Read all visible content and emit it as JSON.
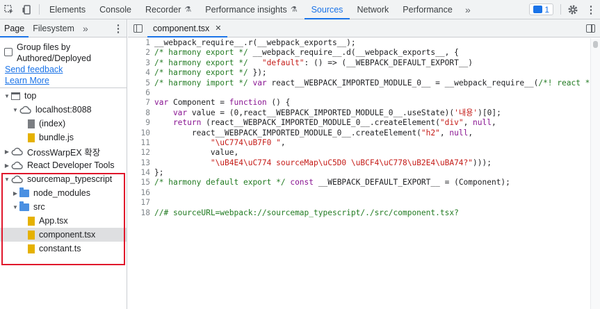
{
  "toolbar": {
    "tabs": [
      {
        "label": "Elements"
      },
      {
        "label": "Console"
      },
      {
        "label": "Recorder"
      },
      {
        "label": "Performance insights"
      },
      {
        "label": "Sources"
      },
      {
        "label": "Network"
      },
      {
        "label": "Performance"
      }
    ],
    "active_tab": "Sources",
    "issues_count": "1",
    "icons": [
      "inspect-icon",
      "device-toggle-icon",
      "more-tabs-icon",
      "issues-icon",
      "settings-icon",
      "kebab-menu-icon"
    ],
    "accent_color": "#1a73e8"
  },
  "navigator": {
    "tabs": [
      {
        "label": "Page"
      },
      {
        "label": "Filesystem"
      }
    ],
    "more_label": "»",
    "group_files_label": "Group files by Authored/Deployed",
    "group_files_checked": false,
    "send_feedback": "Send feedback",
    "learn_more": "Learn More",
    "tree": {
      "top": "top",
      "localhost": "localhost:8088",
      "index": "(index)",
      "bundle": "bundle.js",
      "crosswarp": "CrossWarpEX 확장",
      "react_dev": "React Developer Tools",
      "sourcemap": "sourcemap_typescript",
      "node_modules": "node_modules",
      "src": "src",
      "app": "App.tsx",
      "component": "component.tsx",
      "constant": "constant.ts"
    },
    "selected_file": "component.tsx",
    "highlight_color": "#e0162b"
  },
  "editor": {
    "open_file": "component.tsx",
    "close_label": "✕",
    "lines": [
      {
        "n": "1"
      },
      {
        "n": "2"
      },
      {
        "n": "3"
      },
      {
        "n": "4"
      },
      {
        "n": "5"
      },
      {
        "n": "6"
      },
      {
        "n": "7"
      },
      {
        "n": "8"
      },
      {
        "n": "9"
      },
      {
        "n": "10"
      },
      {
        "n": "11"
      },
      {
        "n": "12"
      },
      {
        "n": "13"
      },
      {
        "n": "14"
      },
      {
        "n": "15"
      },
      {
        "n": "16"
      },
      {
        "n": "17"
      },
      {
        "n": "18"
      }
    ],
    "code": {
      "l1": "__webpack_require__.r(__webpack_exports__);",
      "l2a": "/* harmony export */",
      "l2b": " __webpack_require__.d(__webpack_exports__, {",
      "l3a": "/* harmony export */",
      "l3b": "   \"default\"",
      "l3c": ": () => (__WEBPACK_DEFAULT_EXPORT__)",
      "l4a": "/* harmony export */",
      "l4b": " });",
      "l5a": "/* harmony import */",
      "l5b": " var",
      "l5c": " react__WEBPACK_IMPORTED_MODULE_0__ = __webpack_require__(",
      "l5d": "/*! react */",
      "l7a": "var",
      "l7b": " Component = ",
      "l7c": "function",
      "l7d": " () {",
      "l8a": "    var",
      "l8b": " value = (0,react__WEBPACK_IMPORTED_MODULE_0__.useState)(",
      "l8c": "'내용'",
      "l8d": ")[0];",
      "l9a": "    return",
      "l9b": " (react__WEBPACK_IMPORTED_MODULE_0__.createElement(",
      "l9c": "\"div\"",
      "l9d": ", ",
      "l9e": "null",
      "l9f": ",",
      "l10a": "        react__WEBPACK_IMPORTED_MODULE_0__.createElement(",
      "l10b": "\"h2\"",
      "l10c": ", ",
      "l10d": "null",
      "l10e": ",",
      "l11": "\"\\uC774\\uB7F0 \"",
      "l11b": ",",
      "l12": "            value,",
      "l13a": "\"\\uB4E4\\uC774 sourceMap\\uC5D0 \\uBCF4\\uC778\\uB2E4\\uBA74?\"",
      "l13b": ")));",
      "l14": "};",
      "l15a": "/* harmony default export */",
      "l15b": " const",
      "l15c": " __WEBPACK_DEFAULT_EXPORT__ = (Component);",
      "l18": "//# sourceURL=webpack://sourcemap_typescript/./src/component.tsx?"
    }
  }
}
